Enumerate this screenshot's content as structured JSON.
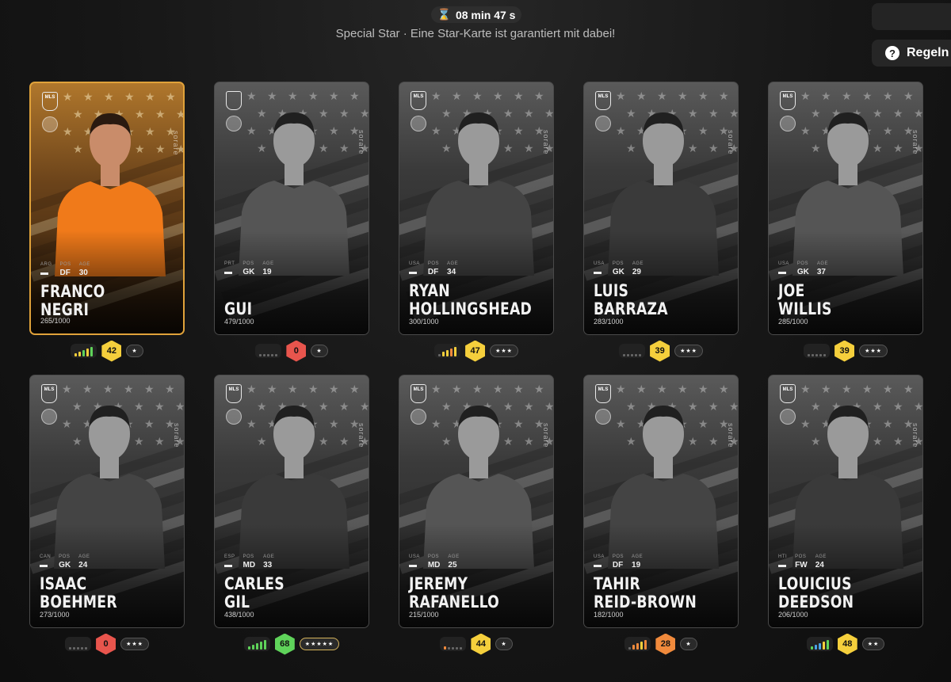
{
  "header": {
    "timer": "08 min 47 s",
    "subtitle": "Special Star · Eine Star-Karte ist garantiert mit dabei!",
    "rules_label": "Regeln"
  },
  "colors": {
    "score_yellow": "#f5cf3c",
    "score_red": "#e8554d",
    "score_green": "#5fd35a",
    "score_orange": "#f08a3c",
    "card_gold_border": "#e0a23a"
  },
  "cards": [
    {
      "first": "FRANCO",
      "last": "NEGRI",
      "nat": "ARG",
      "pos": "DF",
      "age": "30",
      "serial": "265/1000",
      "score": "42",
      "score_color": "yellow",
      "stars": "★",
      "form": [
        "#f5cf3c",
        "#f5cf3c",
        "#5fd35a",
        "#f5cf3c",
        "#5fd35a"
      ],
      "league": "MLS",
      "highlight": true
    },
    {
      "first": "",
      "last": "GUI",
      "nat": "PRT",
      "pos": "GK",
      "age": "19",
      "serial": "479/1000",
      "score": "0",
      "score_color": "red",
      "stars": "★",
      "form": [
        "#666",
        "#666",
        "#666",
        "#666",
        "#666"
      ],
      "league": "",
      "highlight": false
    },
    {
      "first": "RYAN",
      "last": "HOLLINGSHEAD",
      "nat": "USA",
      "pos": "DF",
      "age": "34",
      "serial": "300/1000",
      "score": "47",
      "score_color": "yellow",
      "stars": "★★★",
      "form": [
        "#666",
        "#f5cf3c",
        "#f5cf3c",
        "#f08a3c",
        "#f5cf3c"
      ],
      "league": "MLS",
      "highlight": false
    },
    {
      "first": "LUIS",
      "last": "BARRAZA",
      "nat": "USA",
      "pos": "GK",
      "age": "29",
      "serial": "283/1000",
      "score": "39",
      "score_color": "yellow",
      "stars": "★★★",
      "form": [
        "#666",
        "#666",
        "#666",
        "#666",
        "#666"
      ],
      "league": "MLS",
      "highlight": false
    },
    {
      "first": "JOE",
      "last": "WILLIS",
      "nat": "USA",
      "pos": "GK",
      "age": "37",
      "serial": "285/1000",
      "score": "39",
      "score_color": "yellow",
      "stars": "★★★",
      "form": [
        "#666",
        "#666",
        "#666",
        "#666",
        "#666"
      ],
      "league": "MLS",
      "highlight": false
    },
    {
      "first": "ISAAC",
      "last": "BOEHMER",
      "nat": "CAN",
      "pos": "GK",
      "age": "24",
      "serial": "273/1000",
      "score": "0",
      "score_color": "red",
      "stars": "★★★",
      "form": [
        "#666",
        "#666",
        "#666",
        "#666",
        "#666"
      ],
      "league": "MLS",
      "highlight": false
    },
    {
      "first": "CARLES",
      "last": "GIL",
      "nat": "ESP",
      "pos": "MD",
      "age": "33",
      "serial": "438/1000",
      "score": "68",
      "score_color": "green",
      "stars": "★★★★★",
      "form": [
        "#5fd35a",
        "#5fd35a",
        "#5fd35a",
        "#5fd35a",
        "#5fd35a"
      ],
      "league": "MLS",
      "highlight": false
    },
    {
      "first": "JEREMY",
      "last": "RAFANELLO",
      "nat": "USA",
      "pos": "MD",
      "age": "25",
      "serial": "215/1000",
      "score": "44",
      "score_color": "yellow",
      "stars": "★",
      "form": [
        "#f08a3c",
        "#666",
        "#666",
        "#666",
        "#666"
      ],
      "league": "MLS",
      "highlight": false
    },
    {
      "first": "TAHIR",
      "last": "REID-BROWN",
      "nat": "USA",
      "pos": "DF",
      "age": "19",
      "serial": "182/1000",
      "score": "28",
      "score_color": "orange",
      "stars": "★",
      "form": [
        "#666",
        "#f08a3c",
        "#f08a3c",
        "#f5cf3c",
        "#f08a3c"
      ],
      "league": "MLS",
      "highlight": false
    },
    {
      "first": "LOUICIUS",
      "last": "DEEDSON",
      "nat": "HTI",
      "pos": "FW",
      "age": "24",
      "serial": "206/1000",
      "score": "48",
      "score_color": "yellow",
      "stars": "★★",
      "form": [
        "#5fd35a",
        "#4aa3e8",
        "#4aa3e8",
        "#f5cf3c",
        "#5fd35a"
      ],
      "league": "MLS",
      "highlight": false
    }
  ],
  "labels": {
    "pos": "POS",
    "age": "AGE",
    "brand": "sorare"
  }
}
